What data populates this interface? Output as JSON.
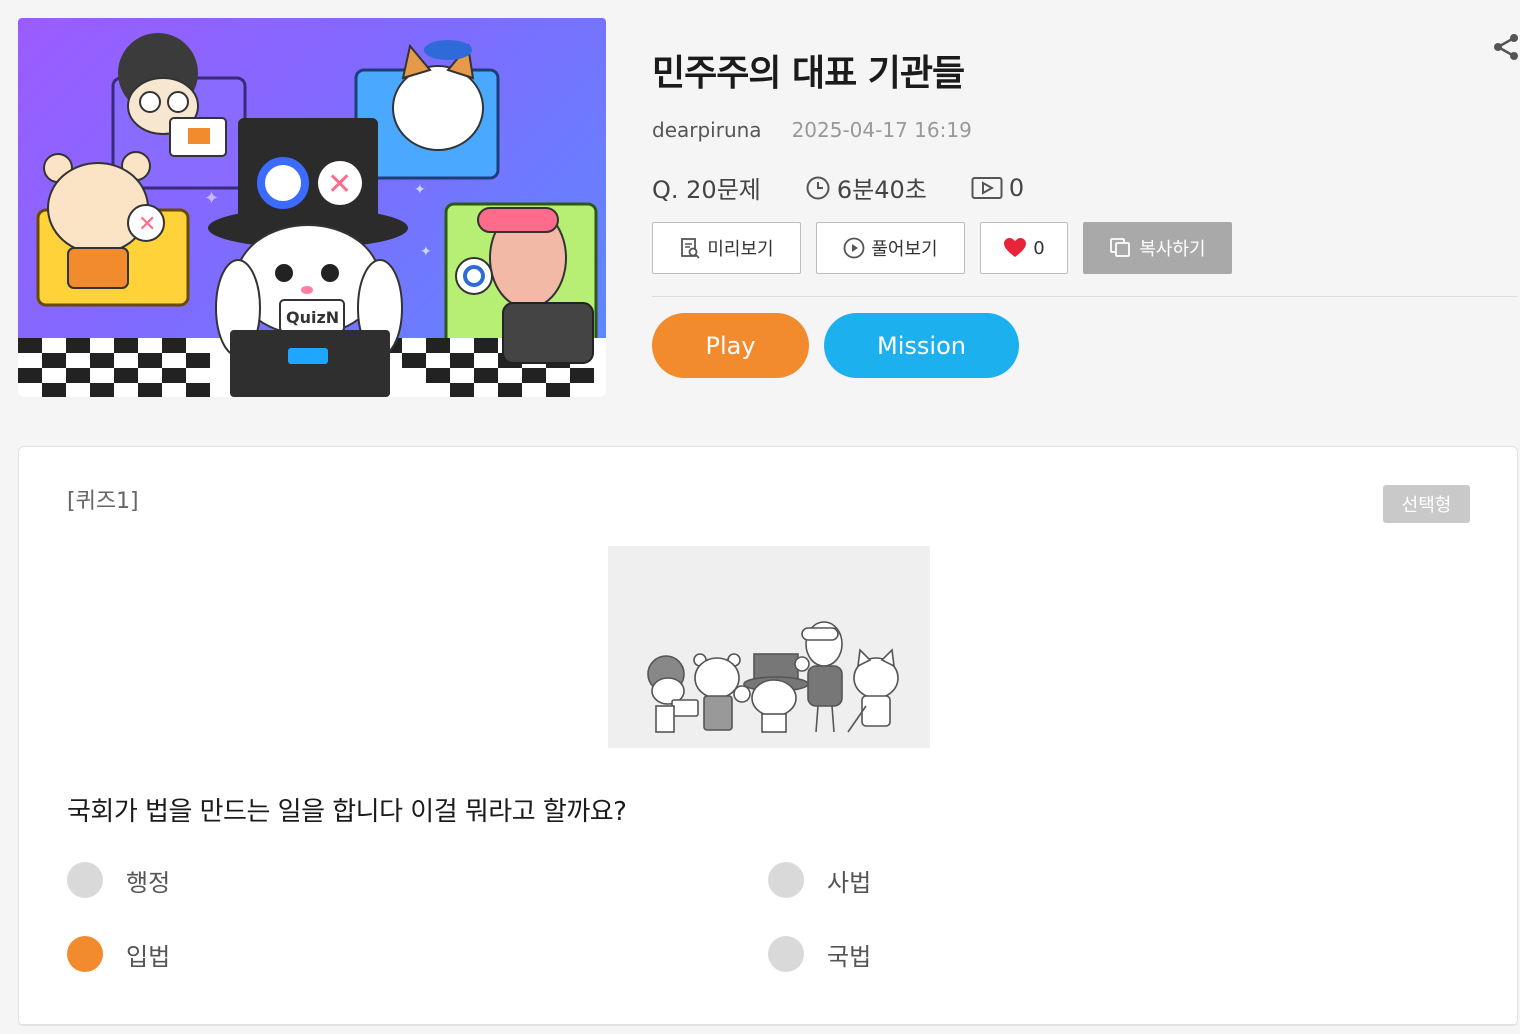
{
  "quiz": {
    "title": "민주주의 대표 기관들",
    "author": "dearpiruna",
    "date": "2025-04-17 16:19",
    "question_count": "Q. 20문제",
    "duration": "6분40초",
    "play_count": "0",
    "thumbnail_text": "QuizN"
  },
  "actions": {
    "preview_label": "미리보기",
    "solve_label": "풀어보기",
    "like_count": "0",
    "copy_label": "복사하기",
    "play_label": "Play",
    "mission_label": "Mission"
  },
  "card": {
    "quiz_label": "[퀴즈1]",
    "type_badge": "선택형",
    "question": "국회가 법을 만드는 일을 합니다 이걸 뭐라고 할까요?",
    "options": [
      {
        "label": "행정",
        "selected": false
      },
      {
        "label": "사법",
        "selected": false
      },
      {
        "label": "입법",
        "selected": true
      },
      {
        "label": "국법",
        "selected": false
      }
    ]
  },
  "colors": {
    "accent_orange": "#f28a2e",
    "accent_blue": "#1cb0ef",
    "heart_red": "#e8243b"
  }
}
